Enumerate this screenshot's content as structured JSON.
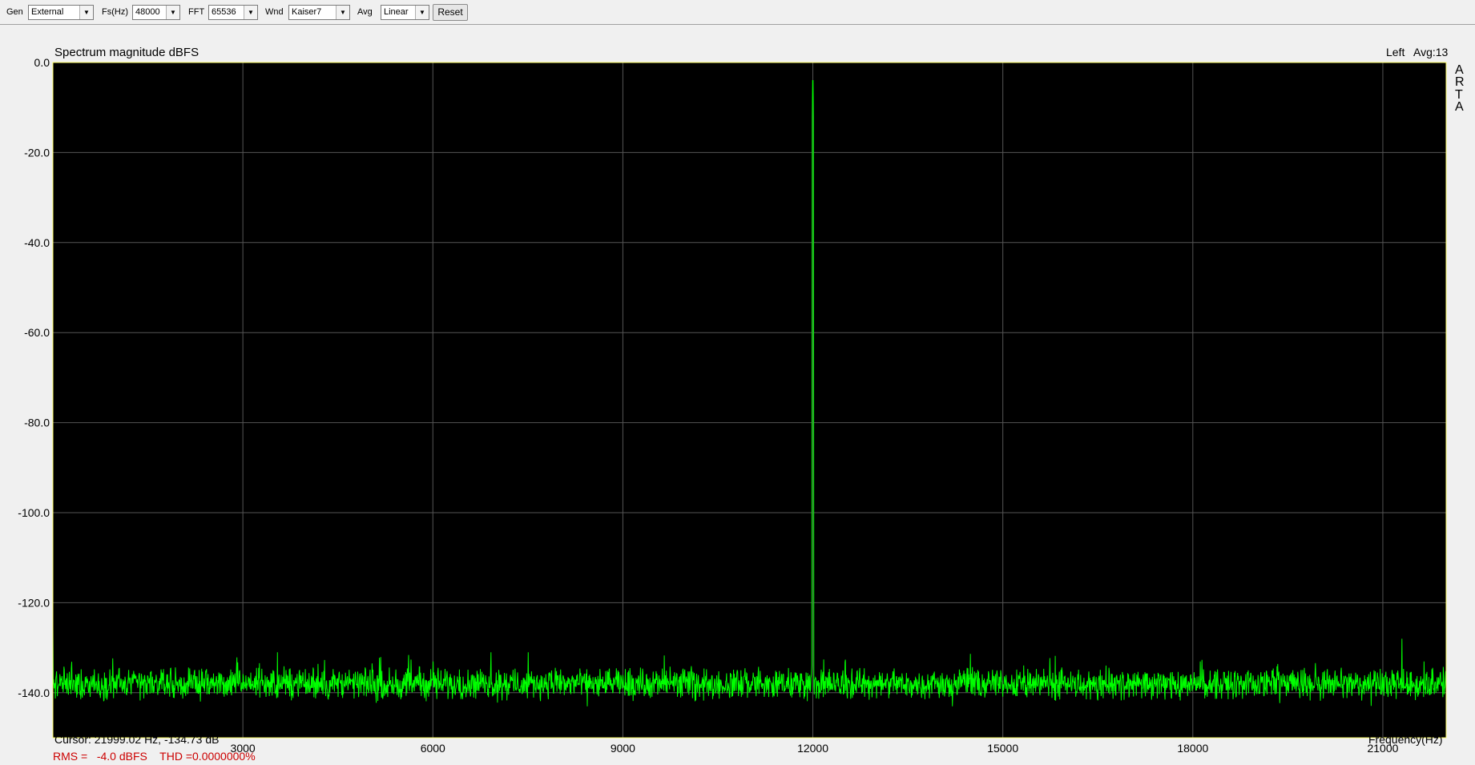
{
  "toolbar": {
    "gen_label": "Gen",
    "gen_value": "External",
    "fs_label": "Fs(Hz)",
    "fs_value": "48000",
    "fft_label": "FFT",
    "fft_value": "65536",
    "wnd_label": "Wnd",
    "wnd_value": "Kaiser7",
    "avg_label": "Avg",
    "avg_value": "Linear",
    "reset_label": "Reset"
  },
  "status": {
    "channel": "Left",
    "avg": "Avg:13",
    "brand_letters": [
      "A",
      "R",
      "T",
      "A"
    ],
    "cursor": "Cursor: 21999.02 Hz, -134.73 dB",
    "rms": "RMS =   -4.0 dBFS    THD =0.0000000%"
  },
  "colors": {
    "plot_bg": "#000000",
    "trace": "#00ff00",
    "grid": "#555555",
    "frame": "#ffff66",
    "rms_text": "#cc0000"
  },
  "chart_data": {
    "type": "line",
    "title": "Spectrum magnitude dBFS",
    "xlabel": "Frequency(Hz)",
    "ylabel": "",
    "xlim": [
      0,
      22000
    ],
    "ylim": [
      -150,
      0
    ],
    "x_ticks": [
      3000,
      6000,
      9000,
      12000,
      15000,
      18000,
      21000
    ],
    "x_tick_labels": [
      "3000",
      "6000",
      "9000",
      "12000",
      "15000",
      "18000",
      "21000"
    ],
    "y_ticks": [
      0,
      -20,
      -40,
      -60,
      -80,
      -100,
      -120,
      -140
    ],
    "y_tick_labels": [
      "0.0",
      "-20.0",
      "-40.0",
      "-60.0",
      "-80.0",
      "-100.0",
      "-120.0",
      "-140.0"
    ],
    "grid": true,
    "noise_floor_db": -138,
    "noise_range_db": [
      -143,
      -131
    ],
    "peaks": [
      {
        "x": 12000,
        "y": -4
      },
      {
        "x": 0,
        "y": -125
      },
      {
        "x": 21300,
        "y": -128
      }
    ]
  }
}
